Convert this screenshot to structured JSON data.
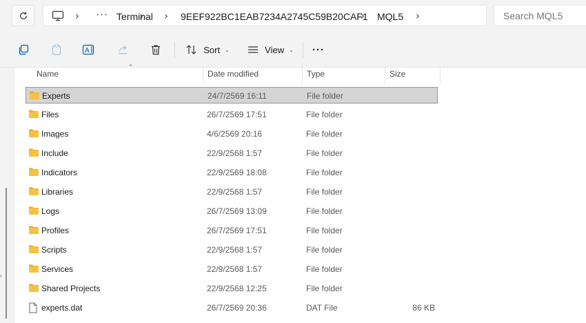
{
  "address_bar": {
    "more": "···",
    "crumbs": [
      "Terminal",
      "9EEF922BC1EAB7234A2745C59B20CAF1",
      "MQL5"
    ]
  },
  "search": {
    "placeholder": "Search MQL5"
  },
  "command_bar": {
    "sort_label": "Sort",
    "view_label": "View",
    "more": "···"
  },
  "columns": {
    "name": "Name",
    "date": "Date modified",
    "type": "Type",
    "size": "Size"
  },
  "files": [
    {
      "name": "Experts",
      "date": "24/7/2569 16:11",
      "type": "File folder",
      "size": "",
      "icon": "folder-icon"
    },
    {
      "name": "Files",
      "date": "26/7/2569 17:51",
      "type": "File folder",
      "size": "",
      "icon": "folder-icon"
    },
    {
      "name": "Images",
      "date": "4/6/2569 20:16",
      "type": "File folder",
      "size": "",
      "icon": "folder-icon"
    },
    {
      "name": "Include",
      "date": "22/9/2568 1:57",
      "type": "File folder",
      "size": "",
      "icon": "folder-icon"
    },
    {
      "name": "Indicators",
      "date": "22/9/2569 18:08",
      "type": "File folder",
      "size": "",
      "icon": "folder-icon"
    },
    {
      "name": "Libraries",
      "date": "22/9/2568 1:57",
      "type": "File folder",
      "size": "",
      "icon": "folder-icon"
    },
    {
      "name": "Logs",
      "date": "26/7/2569 13:09",
      "type": "File folder",
      "size": "",
      "icon": "folder-icon"
    },
    {
      "name": "Profiles",
      "date": "26/7/2569 17:51",
      "type": "File folder",
      "size": "",
      "icon": "folder-icon"
    },
    {
      "name": "Scripts",
      "date": "22/9/2568 1:57",
      "type": "File folder",
      "size": "",
      "icon": "folder-icon"
    },
    {
      "name": "Services",
      "date": "22/9/2568 1:57",
      "type": "File folder",
      "size": "",
      "icon": "folder-icon"
    },
    {
      "name": "Shared Projects",
      "date": "22/9/2568 12:25",
      "type": "File folder",
      "size": "",
      "icon": "folder-icon"
    },
    {
      "name": "experts.dat",
      "date": "26/7/2569 20:36",
      "type": "DAT File",
      "size": "86 KB",
      "icon": "file-icon"
    }
  ],
  "selected_index": 0,
  "colors": {
    "accent": "#005fb8",
    "folder": "#f5c242",
    "selection": "#d4d4d4"
  }
}
